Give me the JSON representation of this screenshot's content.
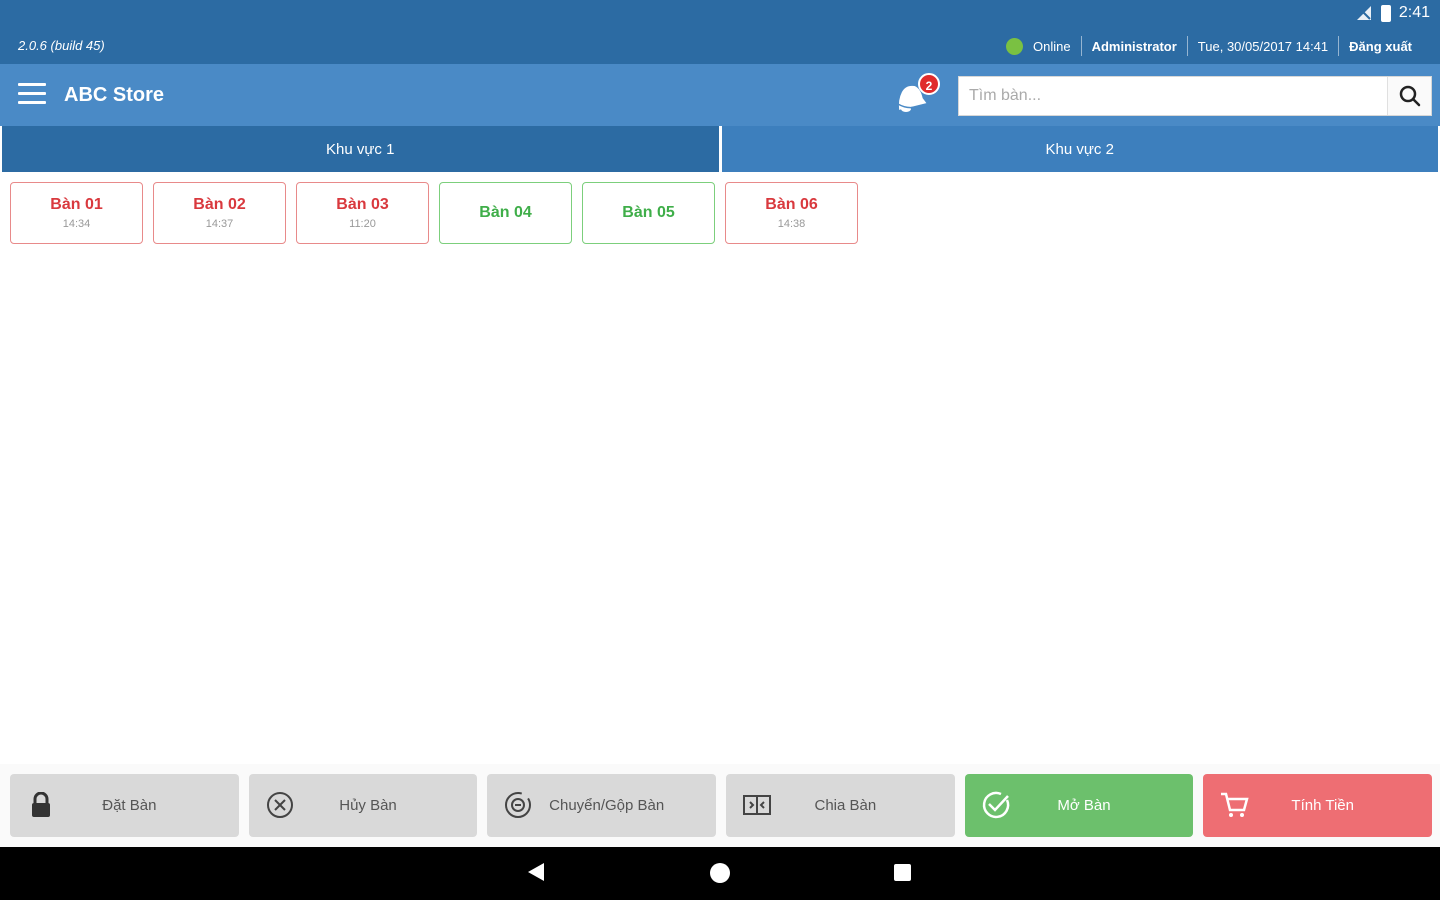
{
  "status_bar": {
    "time": "2:41"
  },
  "info_bar": {
    "version": "2.0.6 (build 45)",
    "connection_status": "Online",
    "user": "Administrator",
    "datetime": "Tue, 30/05/2017 14:41",
    "logout_label": "Đăng xuất"
  },
  "toolbar": {
    "store_name": "ABC Store",
    "notification_count": "2",
    "search_placeholder": "Tìm bàn..."
  },
  "tabs": [
    {
      "label": "Khu vực 1",
      "active": true
    },
    {
      "label": "Khu vực 2",
      "active": false
    }
  ],
  "tables": [
    {
      "name": "Bàn 01",
      "time": "14:34",
      "status": "busy"
    },
    {
      "name": "Bàn 02",
      "time": "14:37",
      "status": "busy"
    },
    {
      "name": "Bàn 03",
      "time": "11:20",
      "status": "busy"
    },
    {
      "name": "Bàn 04",
      "time": "",
      "status": "free"
    },
    {
      "name": "Bàn 05",
      "time": "",
      "status": "free"
    },
    {
      "name": "Bàn 06",
      "time": "14:38",
      "status": "busy"
    }
  ],
  "actions": {
    "reserve": "Đặt Bàn",
    "cancel": "Hủy Bàn",
    "move_merge": "Chuyển/Gộp Bàn",
    "split": "Chia Bàn",
    "open": "Mở Bàn",
    "checkout": "Tính Tiền"
  },
  "colors": {
    "primary_dark": "#2c6ba3",
    "primary": "#4a8ac6",
    "busy": "#d9393e",
    "free": "#3fae49",
    "open_button": "#6cc06c",
    "checkout_button": "#ee6e73"
  }
}
